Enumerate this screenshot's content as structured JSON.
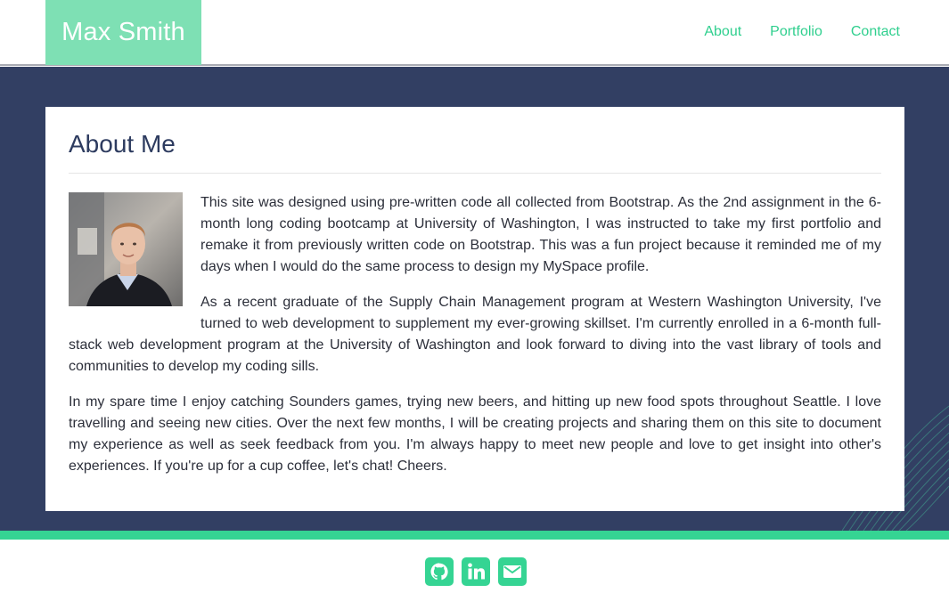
{
  "brand": {
    "name": "Max Smith"
  },
  "nav": {
    "items": [
      {
        "label": "About"
      },
      {
        "label": "Portfolio"
      },
      {
        "label": "Contact"
      }
    ]
  },
  "about": {
    "heading": "About Me",
    "paragraphs": [
      "This site was designed using pre-written code all collected from Bootstrap. As the 2nd assignment in the 6-month long coding bootcamp at University of Washington, I was instructed to take my first portfolio and remake it from previously written code on Bootstrap. This was a fun project because it reminded me of my days when I would do the same process to design my MySpace profile.",
      "As a recent graduate of the Supply Chain Management program at Western Washington University, I've turned to web development to supplement my ever-growing skillset. I'm currently enrolled in a 6-month full-stack web development program at the University of Washington and look forward to diving into the vast library of tools and communities to develop my coding sills.",
      "In my spare time I enjoy catching Sounders games, trying new beers, and hitting up new food spots throughout Seattle. I love travelling and seeing new cities. Over the next few months, I will be creating projects and sharing them on this site to document my experience as well as seek feedback from you. I'm always happy to meet new people and love to get insight into other's experiences. If you're up for a cup coffee, let's chat! Cheers."
    ]
  },
  "footer": {
    "social": [
      {
        "icon": "github-icon"
      },
      {
        "icon": "linkedin-icon"
      },
      {
        "icon": "email-icon"
      }
    ]
  },
  "colors": {
    "accent": "#2fcf8e",
    "brand_bg": "#7ee0b4",
    "hero_bg": "#323f63",
    "heading": "#2d3b5f"
  }
}
